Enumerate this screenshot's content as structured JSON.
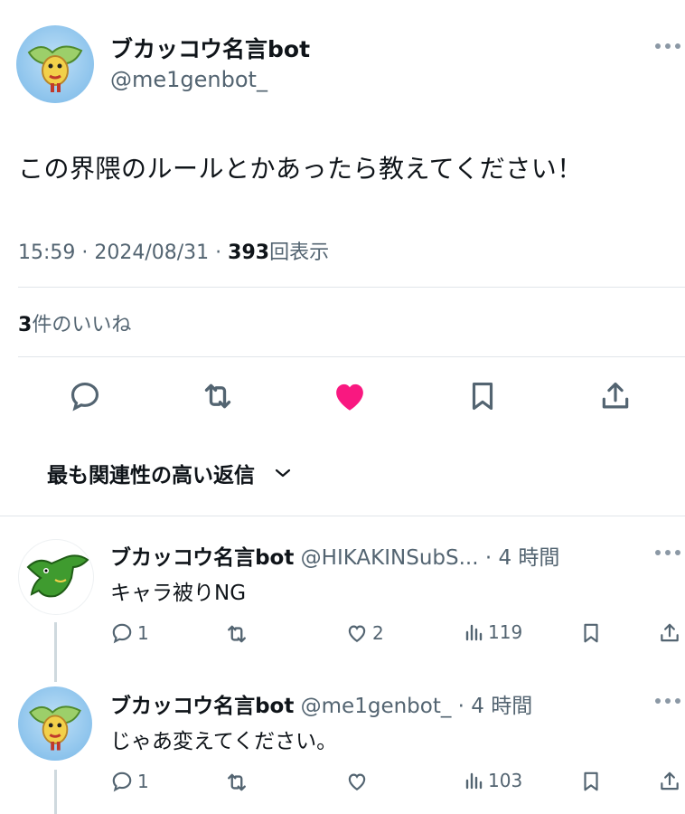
{
  "main_tweet": {
    "name": "ブカッコウ名言bot",
    "handle": "@me1genbot_",
    "text": "この界隈のルールとかあったら教えてください！",
    "time": "15:59 · 2024/08/31 · ",
    "views_count": "393",
    "views_label": "回表示",
    "likes_count": "3",
    "likes_label": "件のいいね",
    "liked": true,
    "like_color": "#f91880"
  },
  "sort": {
    "label": "最も関連性の高い返信"
  },
  "replies": [
    {
      "name": "ブカッコウ名言bot",
      "handle": "@HIKAKINSubS... · 4 時間",
      "text": "キャラ被りNG",
      "reply_count": "1",
      "retweet_count": "",
      "like_count": "2",
      "view_count": "119"
    },
    {
      "name": "ブカッコウ名言bot",
      "handle": "@me1genbot_ · 4 時間",
      "text": "じゃあ変えてください。",
      "reply_count": "1",
      "retweet_count": "",
      "like_count": "",
      "view_count": "103"
    }
  ],
  "colors": {
    "text": "#0f1419",
    "muted": "#536471",
    "like": "#f91880",
    "avatar_bg": "#8cc3ec"
  }
}
